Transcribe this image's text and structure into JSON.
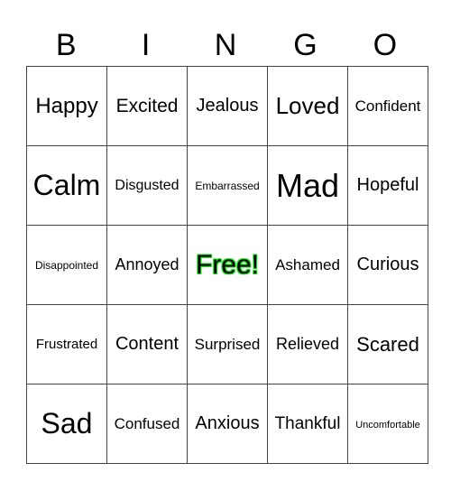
{
  "header": [
    "B",
    "I",
    "N",
    "G",
    "O"
  ],
  "free_color": "#00ff00",
  "rows": [
    [
      {
        "text": "Happy",
        "size": 24
      },
      {
        "text": "Excited",
        "size": 21
      },
      {
        "text": "Jealous",
        "size": 20
      },
      {
        "text": "Loved",
        "size": 26
      },
      {
        "text": "Confident",
        "size": 17
      }
    ],
    [
      {
        "text": "Calm",
        "size": 32
      },
      {
        "text": "Disgusted",
        "size": 16
      },
      {
        "text": "Embarrassed",
        "size": 12
      },
      {
        "text": "Mad",
        "size": 36
      },
      {
        "text": "Hopeful",
        "size": 20
      }
    ],
    [
      {
        "text": "Disappointed",
        "size": 12
      },
      {
        "text": "Annoyed",
        "size": 18
      },
      {
        "text": "Free!",
        "size": 30,
        "free": true
      },
      {
        "text": "Ashamed",
        "size": 17
      },
      {
        "text": "Curious",
        "size": 20
      }
    ],
    [
      {
        "text": "Frustrated",
        "size": 15
      },
      {
        "text": "Content",
        "size": 20
      },
      {
        "text": "Surprised",
        "size": 17
      },
      {
        "text": "Relieved",
        "size": 18
      },
      {
        "text": "Scared",
        "size": 22
      }
    ],
    [
      {
        "text": "Sad",
        "size": 32
      },
      {
        "text": "Confused",
        "size": 17
      },
      {
        "text": "Anxious",
        "size": 20
      },
      {
        "text": "Thankful",
        "size": 19
      },
      {
        "text": "Uncomfortable",
        "size": 11
      }
    ]
  ]
}
